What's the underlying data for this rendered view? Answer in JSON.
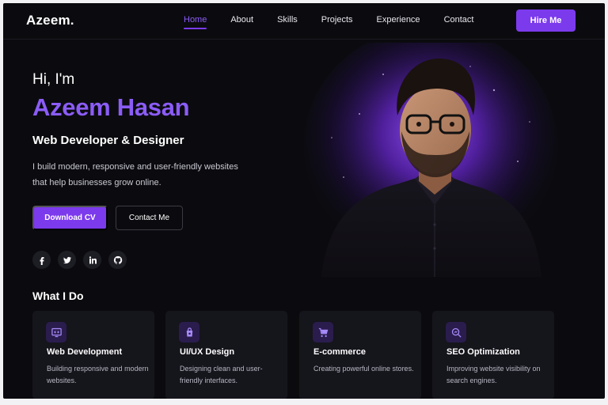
{
  "brand": {
    "logo": "Azeem.",
    "accent": "#7c3aed"
  },
  "nav": {
    "links": [
      "Home",
      "About",
      "Skills",
      "Projects",
      "Experience",
      "Contact"
    ],
    "active": "Home",
    "cta": "Hire Me"
  },
  "hero": {
    "greeting": "Hi, I'm",
    "name": "Azeem Hasan",
    "role": "Web Developer & Designer",
    "description": "I build modern, responsive and user-friendly websites that help businesses grow online.",
    "primary_button": "Download CV",
    "secondary_button": "Contact Me",
    "socials": [
      "facebook-icon",
      "twitter-icon",
      "linkedin-icon",
      "github-icon"
    ]
  },
  "services": {
    "title": "What I Do",
    "items": [
      {
        "icon": "monitor-code-icon",
        "title": "Web Development",
        "text": "Building responsive and modern websites."
      },
      {
        "icon": "design-bag-icon",
        "title": "UI/UX Design",
        "text": "Designing clean and user-friendly interfaces."
      },
      {
        "icon": "cart-icon",
        "title": "E-commerce",
        "text": "Creating powerful online stores."
      },
      {
        "icon": "seo-search-icon",
        "title": "SEO Optimization",
        "text": "Improving website visibility on search engines."
      }
    ]
  }
}
